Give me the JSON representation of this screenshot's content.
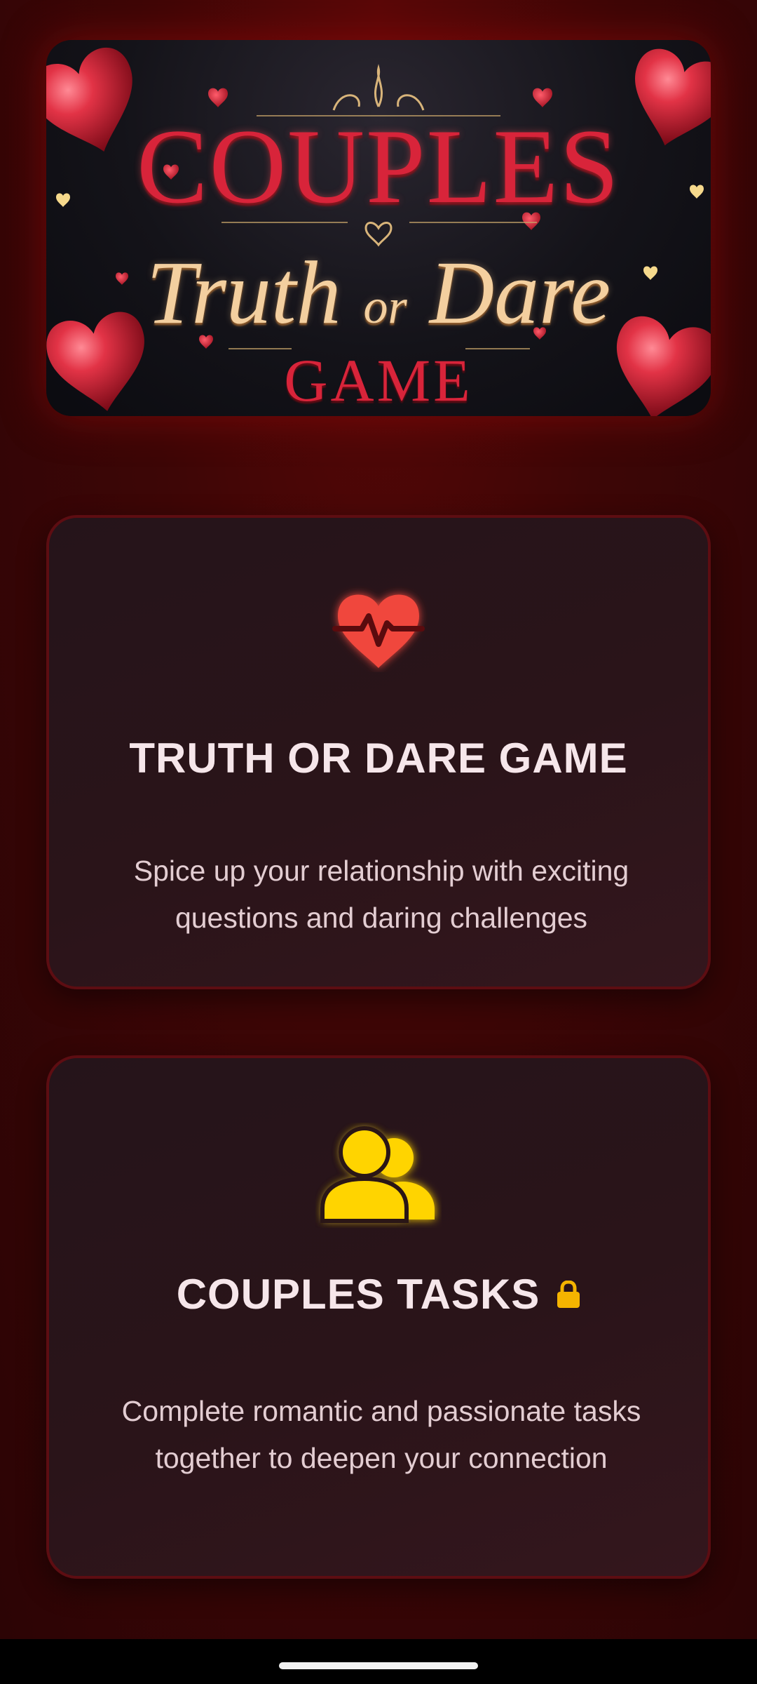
{
  "banner": {
    "title_line1": "COUPLES",
    "title_truth": "Truth",
    "title_or": "or",
    "title_dare": "Dare",
    "title_line3": "GAME"
  },
  "cards": [
    {
      "icon": "heart-pulse-icon",
      "title": "TRUTH OR DARE GAME",
      "description": "Spice up your relationship with exciting questions and daring challenges",
      "icon_color": "#f0463c"
    },
    {
      "icon": "users-icon",
      "title": "COUPLES TASKS",
      "description": "Complete romantic and passionate tasks together to deepen your connection",
      "icon_color": "#ffd400",
      "locked": true,
      "lock_icon": "lock-icon"
    }
  ],
  "theme": {
    "background": "#3d0606",
    "card_border": "#5d0d12",
    "title_text": "#f6e6ea",
    "body_text": "#e3cdd2",
    "accent_red": "#d8243a",
    "accent_gold": "#f3cf9f"
  }
}
